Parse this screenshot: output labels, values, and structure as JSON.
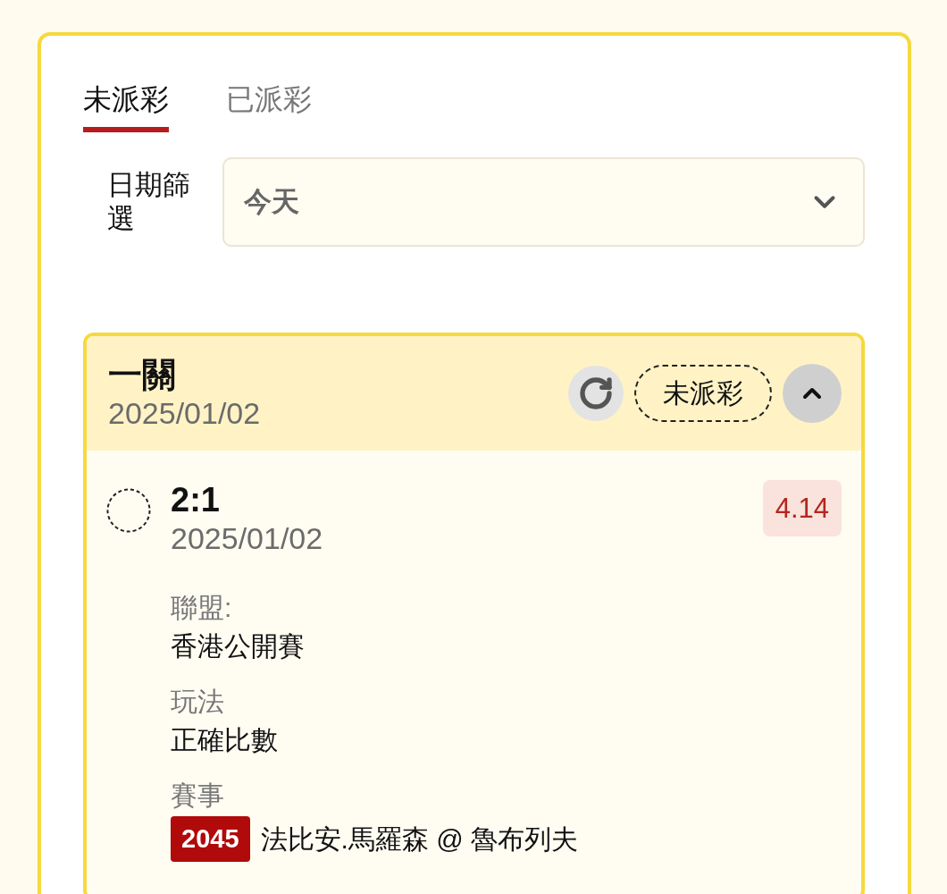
{
  "tabs": [
    {
      "label": "未派彩",
      "selected": true
    },
    {
      "label": "已派彩",
      "selected": false
    }
  ],
  "date_filter": {
    "label": "日期篩選",
    "value": "今天"
  },
  "bet_card": {
    "title": "一關",
    "date": "2025/01/02",
    "status": "未派彩",
    "expanded": true,
    "selections": [
      {
        "score": "2:1",
        "date": "2025/01/02",
        "odds": "4.14",
        "details": [
          {
            "kind": "text",
            "label": "聯盟:",
            "value": "香港公開賽"
          },
          {
            "kind": "text",
            "label": "玩法",
            "value": "正確比數"
          },
          {
            "kind": "match",
            "label": "賽事",
            "match_no": "2045",
            "value": "法比安.馬羅森 @ 魯布列夫"
          }
        ]
      }
    ]
  }
}
